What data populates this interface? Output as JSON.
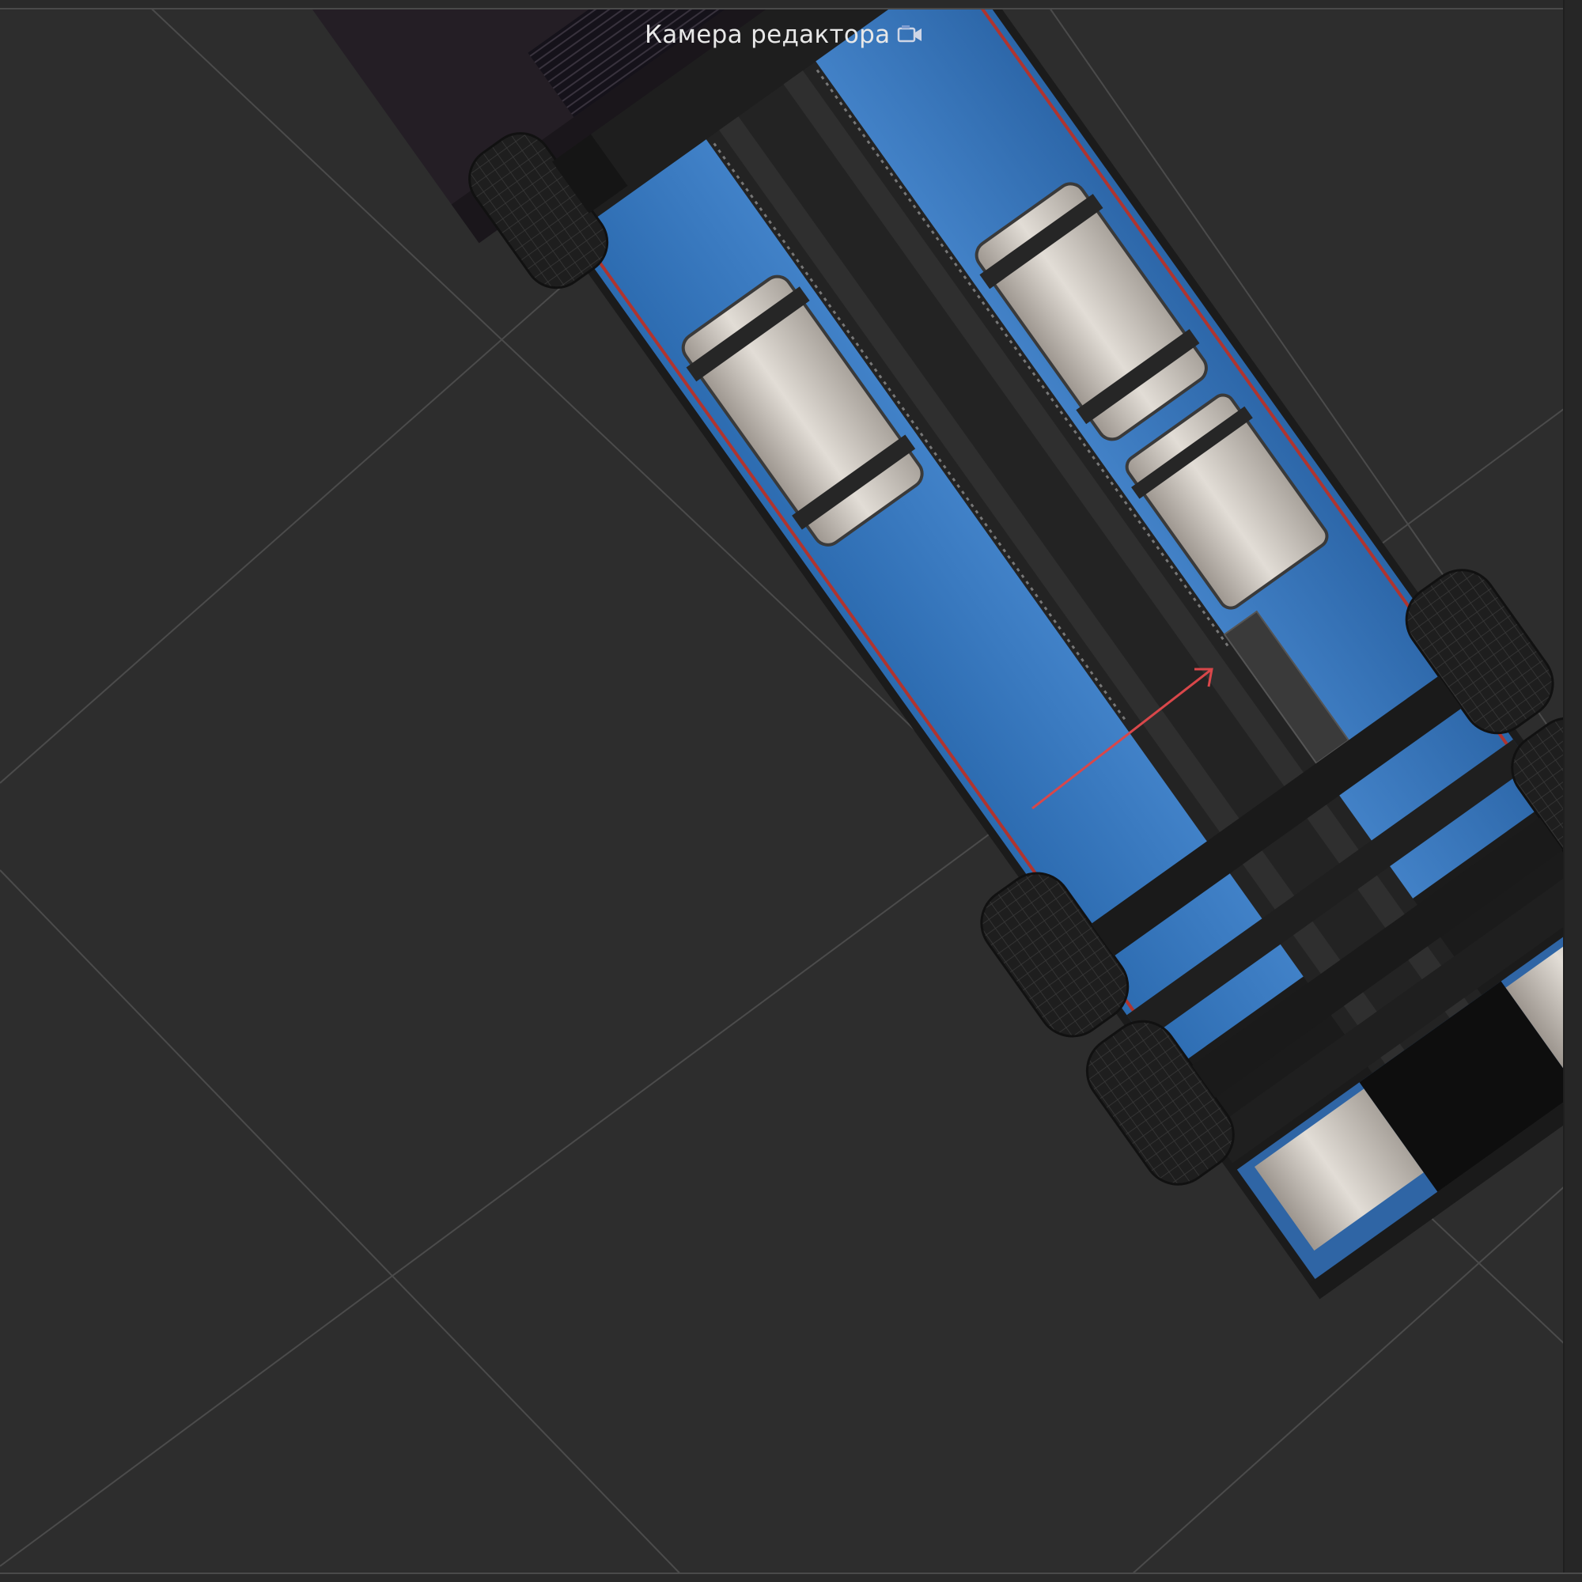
{
  "viewport": {
    "camera_label": "Камера редактора",
    "camera_icon": "video-camera-icon"
  },
  "colors": {
    "background": "#2d2d2d",
    "grid_line": "#5a5a5a",
    "axis_x": "#d9474a",
    "truck_body_blue": "#3f7fc6",
    "truck_frame": "#1f1f1f",
    "truck_cab": "#241e25",
    "fuel_tank": "#d8d3cc"
  }
}
